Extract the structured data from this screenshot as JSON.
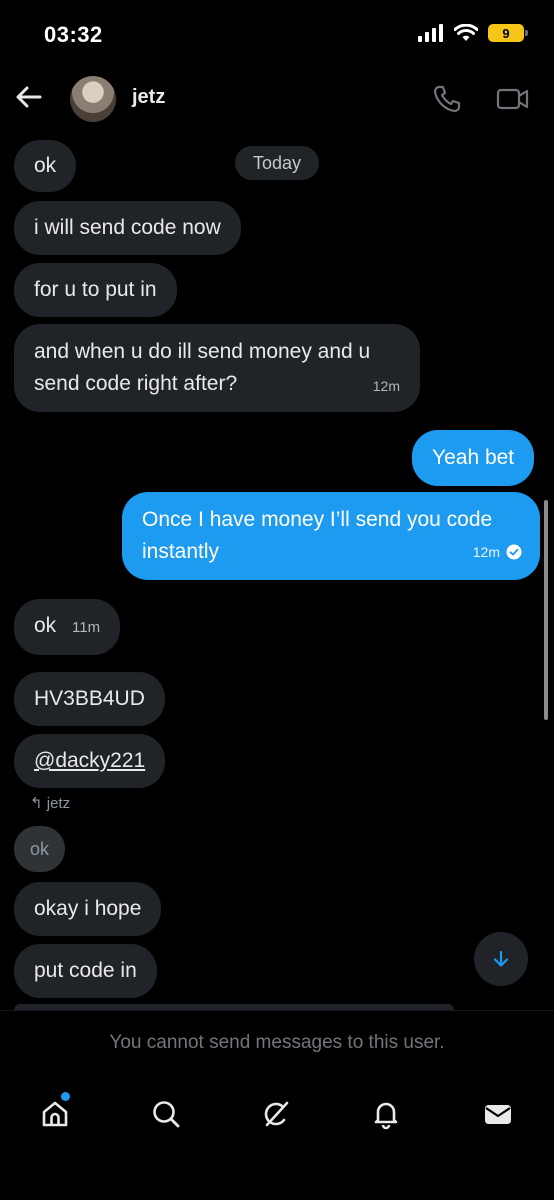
{
  "status": {
    "time": "03:32",
    "battery": "9"
  },
  "header": {
    "username": "jetz"
  },
  "chat": {
    "date_label": "Today",
    "messages": [
      {
        "text": "ok"
      },
      {
        "text": "i will send code now"
      },
      {
        "text": "for u to put in"
      },
      {
        "text": "and when u do ill send money and u send code right after?",
        "time": "12m"
      },
      {
        "text": "Yeah bet"
      },
      {
        "text": "Once I have money I’ll send you code instantly",
        "time": "12m"
      },
      {
        "text": "ok",
        "time": "11m"
      },
      {
        "text": "HV3BB4UD"
      },
      {
        "text": "@dacky221"
      },
      {
        "reply_to": "jetz",
        "text": "ok"
      },
      {
        "text": "okay i hope"
      },
      {
        "text": "put code in"
      }
    ]
  },
  "notice": "You cannot send messages to this user.",
  "nav": {
    "items": [
      "home-icon",
      "search-icon",
      "grok-icon",
      "notifications-icon",
      "messages-icon"
    ]
  },
  "colors": {
    "accent": "#1d9bf0",
    "incoming_bubble": "#202327",
    "background": "#000000"
  }
}
